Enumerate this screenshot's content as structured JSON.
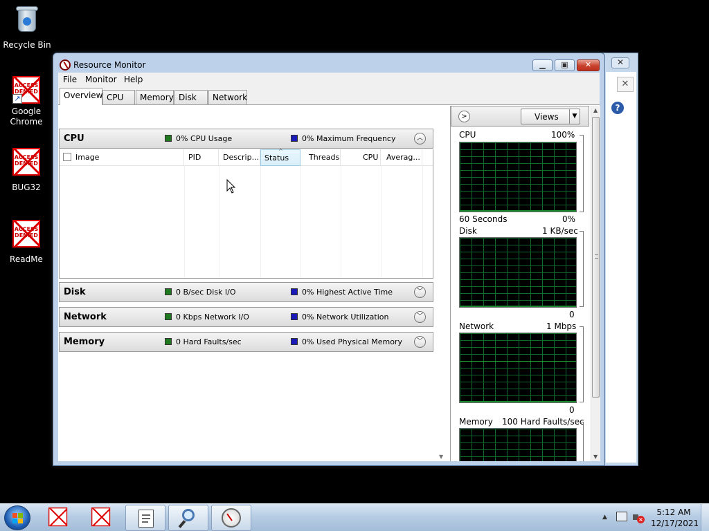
{
  "desktop": {
    "icons": [
      {
        "label": "Recycle Bin"
      },
      {
        "label": "Google Chrome",
        "badge": "ACCESS DENIED"
      },
      {
        "label": "BUG32",
        "badge": "ACCESS DENIED"
      },
      {
        "label": "ReadMe",
        "badge": "ACCESS DENIED"
      }
    ]
  },
  "window": {
    "title": "Resource Monitor",
    "menu": [
      "File",
      "Monitor",
      "Help"
    ],
    "tabs": [
      "Overview",
      "CPU",
      "Memory",
      "Disk",
      "Network"
    ],
    "active_tab": "Overview"
  },
  "sections": {
    "cpu": {
      "name": "CPU",
      "legend1": "0% CPU Usage",
      "legend2": "0% Maximum Frequency",
      "expanded": true
    },
    "disk": {
      "name": "Disk",
      "legend1": "0 B/sec Disk I/O",
      "legend2": "0% Highest Active Time"
    },
    "network": {
      "name": "Network",
      "legend1": "0 Kbps Network I/O",
      "legend2": "0% Network Utilization"
    },
    "memory": {
      "name": "Memory",
      "legend1": "0 Hard Faults/sec",
      "legend2": "0% Used Physical Memory"
    }
  },
  "cpu_table": {
    "columns": [
      "Image",
      "PID",
      "Descrip...",
      "Status",
      "Threads",
      "CPU",
      "Averag..."
    ],
    "sorted_column": "Status",
    "rows": []
  },
  "right_pane": {
    "views_label": "Views",
    "graphs": [
      {
        "name": "CPU",
        "max": "100%",
        "footer_left": "60 Seconds",
        "footer_right": "0%"
      },
      {
        "name": "Disk",
        "max": "1 KB/sec",
        "footer_right": "0"
      },
      {
        "name": "Network",
        "max": "1 Mbps",
        "footer_right": "0"
      },
      {
        "name": "Memory",
        "max": "100 Hard Faults/sec"
      }
    ]
  },
  "taskbar": {
    "items": [
      "access-denied-app-1",
      "access-denied-app-2",
      "notepad",
      "search-tool",
      "resource-monitor"
    ],
    "time": "5:12 AM",
    "date": "12/17/2021"
  },
  "colors": {
    "graph_grid": "#0f6b2a",
    "legend_green": "#1f7a1f",
    "legend_blue": "#1a1ab8",
    "close_button": "#c7402c"
  }
}
